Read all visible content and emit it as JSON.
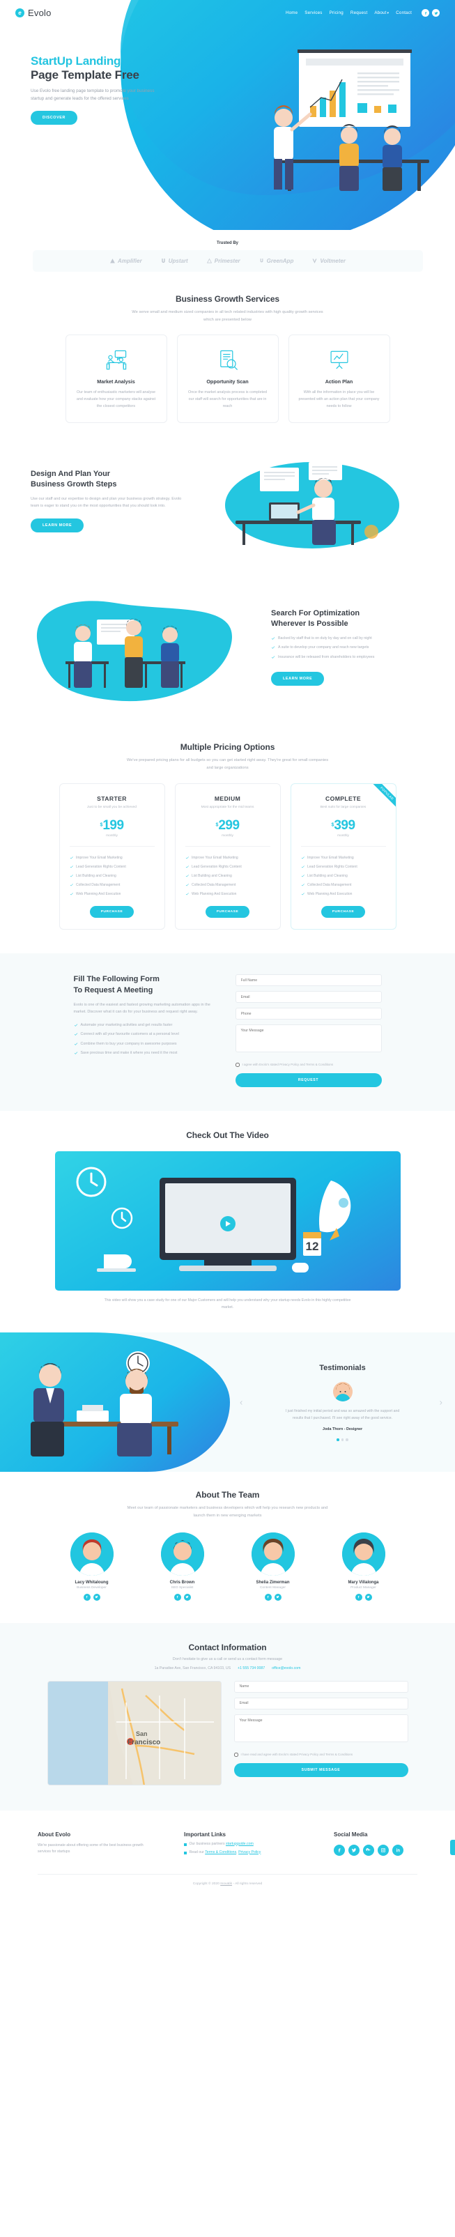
{
  "brand": {
    "name": "Evolo",
    "mark": "e",
    "accent": "#24c6e0"
  },
  "nav": {
    "items": [
      {
        "label": "Home"
      },
      {
        "label": "Services"
      },
      {
        "label": "Pricing"
      },
      {
        "label": "Request"
      },
      {
        "label": "About",
        "caret": "▾"
      },
      {
        "label": "Contact"
      }
    ],
    "social": [
      "facebook-icon",
      "twitter-icon"
    ]
  },
  "hero": {
    "title_line1": "StartUp Landing",
    "title_line2": "Page Template Free",
    "subtitle": "Use Evolo free landing page template to promote your business startup and generate leads for the offered services",
    "cta": "DISCOVER"
  },
  "trusted": {
    "title": "Trusted By",
    "brands": [
      {
        "name": "Amplifier"
      },
      {
        "name": "Upstart"
      },
      {
        "name": "Primester"
      },
      {
        "name": "GreenApp"
      },
      {
        "name": "Voltmeter"
      }
    ]
  },
  "services": {
    "title": "Business Growth Services",
    "subtitle": "We serve small and medium sized companies in all tech related industries with high quality growth services which are presented below",
    "cards": [
      {
        "icon": "meeting-icon",
        "title": "Market Analysis",
        "text": "Our team of enthusiastic marketers will analyse and evaluate how your company stacks against the closest competitors"
      },
      {
        "icon": "search-document-icon",
        "title": "Opportunity Scan",
        "text": "Once the market analysis process is completed our staff will search for opportunities that are in reach"
      },
      {
        "icon": "presentation-icon",
        "title": "Action Plan",
        "text": "With all the information in place you will be presented with an action plan that your company needs to follow"
      }
    ]
  },
  "design": {
    "title_line1": "Design And Plan Your",
    "title_line2": "Business Growth Steps",
    "text": "Use our staff and our expertise to design and plan your business growth strategy. Evolo team is eager to stand you on the most opportunities that you should look into.",
    "cta": "LEARN MORE"
  },
  "optimization": {
    "title_line1": "Search For Optimization",
    "title_line2": "Wherever Is Possible",
    "bullets": [
      "Backed by staff that is on duty by day and on call by night",
      "A suite to develop your company and reach new targets",
      "Insurance will be released from shareholders to employees"
    ],
    "cta": "LEARN MORE"
  },
  "pricing": {
    "title": "Multiple Pricing Options",
    "subtitle": "We've prepared pricing plans for all budgets so you can get started right away. They're great for small companies and large organizations",
    "plans": [
      {
        "name": "STARTER",
        "desc": "Just to be small you be achieved",
        "currency": "$",
        "amount": "199",
        "period": "monthly",
        "features": [
          "Improve Your Email Marketing",
          "Lead Generation Rights Content",
          "List Building and Cleaning",
          "Collected Data Management",
          "Web Planning And Execution"
        ],
        "cta": "PURCHASE",
        "ribbon": ""
      },
      {
        "name": "MEDIUM",
        "desc": "Most appropriate for the mid teams",
        "currency": "$",
        "amount": "299",
        "period": "monthly",
        "features": [
          "Improve Your Email Marketing",
          "Lead Generation Rights Content",
          "List Building and Cleaning",
          "Collected Data Management",
          "Web Planning And Execution"
        ],
        "cta": "PURCHASE",
        "ribbon": ""
      },
      {
        "name": "COMPLETE",
        "desc": "Best suits for large companies",
        "currency": "$",
        "amount": "399",
        "period": "monthly",
        "features": [
          "Improve Your Email Marketing",
          "Lead Generation Rights Content",
          "List Building and Cleaning",
          "Collected Data Management",
          "Web Planning And Execution"
        ],
        "cta": "PURCHASE",
        "ribbon": "POPULAR"
      }
    ]
  },
  "request": {
    "title_line1": "Fill The Following Form",
    "title_line2": "To Request A Meeting",
    "text": "Evolo is one of the easiest and fastest growing marketing automation apps in the market. Discover what it can do for your business and request right away.",
    "bullets": [
      "Automate your marketing activities and get results faster",
      "Connect with all your favourite customers at a personal level",
      "Combine them to buy your company in awesome purposes",
      "Save precious time and make it where you need it the most"
    ],
    "fields": [
      {
        "name": "full-name-field",
        "placeholder": "Full Name"
      },
      {
        "name": "email-field",
        "placeholder": "Email"
      },
      {
        "name": "phone-field",
        "placeholder": "Phone"
      },
      {
        "name": "message-field",
        "placeholder": "Your Message"
      }
    ],
    "consent": "I agree with Evolo's stated Privacy Policy and Terms & Conditions",
    "cta": "REQUEST"
  },
  "video": {
    "title": "Check Out The Video",
    "caption": "This video will show you a case study for one of our Major Customers and will help you understand why your startup needs Evolo in this highly competitive market.",
    "link_text": "Major Customers",
    "play": "play-button"
  },
  "testimonials": {
    "title": "Testimonials",
    "quote": "I just finished my initial period and was so amazed with the support and results that I purchased. I'll see right away of the good service.",
    "author": "Joda Thorn - Designer",
    "prev": "‹",
    "next": "›",
    "dots": 3,
    "active_dot": 0
  },
  "team": {
    "title": "About The Team",
    "subtitle": "Meet our team of passionate marketers and business developers which will help you research new products and launch them in new emerging markets",
    "members": [
      {
        "name": "Lacy Whitaloung",
        "role": "Business Developer"
      },
      {
        "name": "Chris Brown",
        "role": "SEO Specialist"
      },
      {
        "name": "Shelia Zimerman",
        "role": "Content Manager"
      },
      {
        "name": "Mary Villalonga",
        "role": "Product Manager"
      }
    ],
    "social": [
      "facebook-icon",
      "twitter-icon"
    ]
  },
  "contact": {
    "title": "Contact Information",
    "subtitle": "Don't hesitate to give us a call or send us a contact form message",
    "address": "1a Paradise Ave, San Francisco, CA 94103, US",
    "phone": "+1 555 734 0087",
    "email": "office@evolo.com",
    "map_label": "San Francisco",
    "fields": [
      {
        "name": "contact-name-field",
        "placeholder": "Name"
      },
      {
        "name": "contact-email-field",
        "placeholder": "Email"
      },
      {
        "name": "contact-message-field",
        "placeholder": "Your Message"
      }
    ],
    "consent": "I have read and agree with Evolo's stated Privacy Policy and Terms & Conditions",
    "cta": "SUBMIT MESSAGE"
  },
  "footer": {
    "about": {
      "title": "About Evolo",
      "text": "We're passionate about offering some of the best business growth services for startups"
    },
    "links": {
      "title": "Important Links",
      "items": [
        {
          "pre": "Our business partners ",
          "link": "startupguide.com",
          "post": ""
        },
        {
          "pre": "Read our ",
          "link": "Terms & Conditions",
          "post": ", ",
          "link2": "Privacy Policy"
        }
      ]
    },
    "social": {
      "title": "Social Media",
      "icons": [
        "facebook-icon",
        "twitter-icon",
        "google-plus-icon",
        "instagram-icon",
        "linkedin-icon"
      ]
    },
    "copyright_pre": "Copyright © 2020 ",
    "copyright_link": "Inovatik",
    "copyright_post": " - All rights reserved"
  }
}
